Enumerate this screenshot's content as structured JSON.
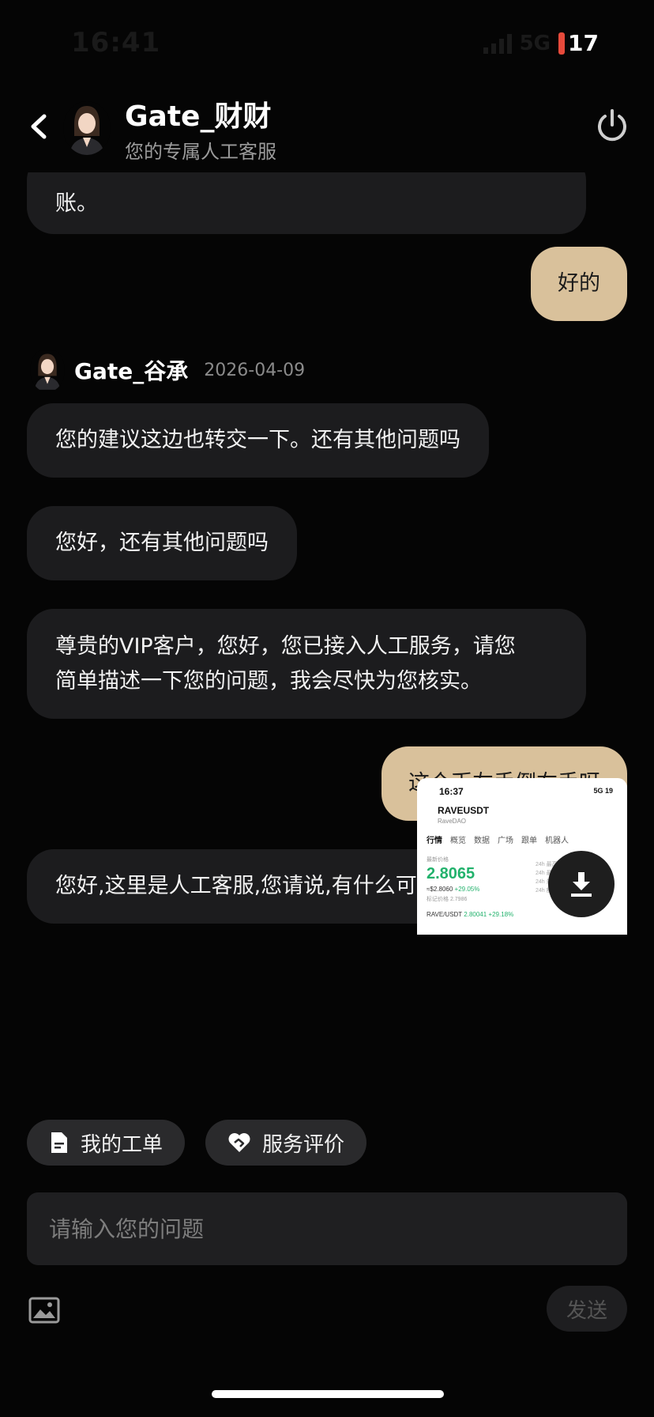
{
  "status_bar": {
    "time": "16:41",
    "network": "5G",
    "battery": "17",
    "battery_color": "#e74a3b"
  },
  "header": {
    "title": "Gate_财财",
    "subtitle": "您的专属人工客服"
  },
  "messages": {
    "partial": "账。",
    "user_1": "好的",
    "agent": {
      "name": "Gate_谷承",
      "date": "2026-04-09"
    },
    "in_1": "您的建议这边也转交一下。还有其他问题吗",
    "in_2": "您好，还有其他问题吗",
    "in_3_line1": "尊贵的VIP客户，您好，您已接入人工服务，请您",
    "in_3_line2": "简单描述一下您的问题，我会尽快为您核实。",
    "user_2": "这个币左手倒右手呀",
    "in_4": "您好,这里是人工客服,您请说,有什么可以帮您~"
  },
  "screenshot": {
    "time": "16:37",
    "status": "5G 19",
    "pair": "RAVEUSDT",
    "project": "RaveDAO",
    "tabs": [
      "行情",
      "概览",
      "数据",
      "广场",
      "跟单",
      "机器人"
    ],
    "label": "最新价格",
    "price": "2.8065",
    "usd": "≈$2.8060",
    "change": "+29.05%",
    "mark": "标记价格 2.7986",
    "footer_pair": "RAVE/USDT",
    "footer_price": "2.80041 +29.18%",
    "side": "24h 最高\n24h 最低\n24h 量\n24h 额"
  },
  "actions": {
    "tickets": "我的工单",
    "rating": "服务评价"
  },
  "composer": {
    "placeholder": "请输入您的问题",
    "send": "发送"
  },
  "colors": {
    "user_bubble": "#d9c19b",
    "agent_bubble": "#1c1c1e",
    "background": "#050505"
  }
}
